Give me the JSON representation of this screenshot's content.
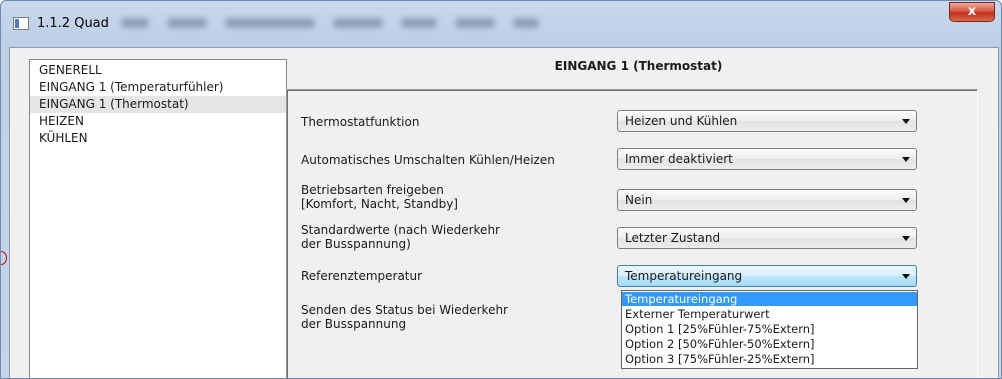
{
  "window": {
    "title": "1.1.2 Quad",
    "close_label": "x"
  },
  "tree": {
    "items": [
      {
        "label": "GENERELL",
        "selected": false
      },
      {
        "label": "EINGANG 1 (Temperaturfühler)",
        "selected": false
      },
      {
        "label": "EINGANG 1 (Thermostat)",
        "selected": true
      },
      {
        "label": "HEIZEN",
        "selected": false
      },
      {
        "label": "KÜHLEN",
        "selected": false
      }
    ]
  },
  "page": {
    "heading": "EINGANG 1 (Thermostat)"
  },
  "params": [
    {
      "label": "Thermostatfunktion",
      "value": "Heizen und Kühlen"
    },
    {
      "label": "Automatisches Umschalten Kühlen/Heizen",
      "value": "Immer deaktiviert"
    },
    {
      "label": "Betriebsarten freigeben [Komfort, Nacht, Standby]",
      "value": "Nein"
    },
    {
      "label": "Standardwerte (nach Wiederkehr der Busspannung)",
      "value": "Letzter Zustand"
    },
    {
      "label": "Referenztemperatur",
      "value": "Temperatureingang"
    },
    {
      "label": "Senden des Status bei Wiederkehr der Busspannung",
      "value": ""
    }
  ],
  "dropdown": {
    "options": [
      "Temperatureingang",
      "Externer Temperaturwert",
      "Option 1 [25%Fühler-75%Extern]",
      "Option 2 [50%Fühler-50%Extern]",
      "Option 3 [75%Fühler-25%Extern]"
    ],
    "highlighted_index": 0
  },
  "colors": {
    "highlight": "#3399ff",
    "close_button": "#c3321a"
  }
}
